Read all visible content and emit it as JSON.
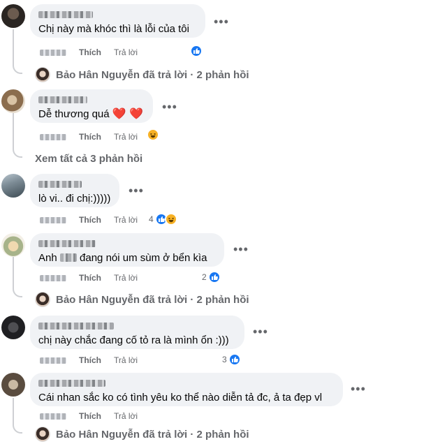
{
  "comments": [
    {
      "text": "Chị này mà khóc thì là lỗi của tôi",
      "like": "Thích",
      "reply": "Trả lời",
      "reaction_count": ""
    },
    {
      "text": "Dễ thương quá",
      "emoji": "❤️ ❤️",
      "like": "Thích",
      "reply": "Trả lời",
      "reaction_count": ""
    },
    {
      "text": "lò vi.. đi chị:)))))",
      "like": "Thích",
      "reply": "Trả lời",
      "reaction_count": "4"
    },
    {
      "text_before": "Anh ",
      "text_after": " đang nói um sùm ở bển kìa",
      "like": "Thích",
      "reply": "Trả lời",
      "reaction_count": "2"
    },
    {
      "text": "chị này chắc đang cố tỏ ra là mình ổn :)))",
      "like": "Thích",
      "reply": "Trả lời",
      "reaction_count": "3"
    },
    {
      "text": "Cái nhan sắc ko có tình yêu ko thể nào diễn tả đc, ả ta đẹp vl",
      "like": "Thích",
      "reply": "Trả lời",
      "reaction_count": ""
    }
  ],
  "reply_summary": "Bảo Hân Nguyễn đã trả lời · 2 phản hồi",
  "view_all": "Xem tất cả 3 phản hồi",
  "more_icon": "•••",
  "colors": {
    "like_blue": "#1877f2",
    "haha_yellow": "#f7b125",
    "heart_red": "#e41e3f",
    "bubble": "#f0f2f5",
    "muted": "#65676b"
  }
}
